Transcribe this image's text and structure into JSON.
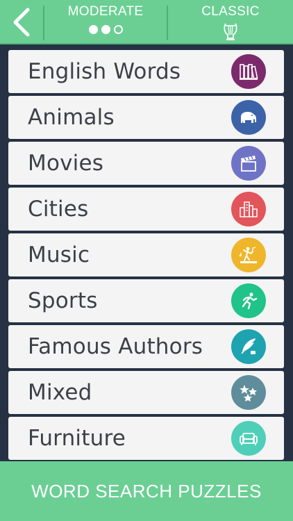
{
  "header": {
    "difficulty_label": "MODERATE",
    "mode_label": "CLASSIC",
    "difficulty_level": 2,
    "difficulty_max": 3,
    "back_icon": "chevron-left-icon",
    "mode_icon": "lyre-icon"
  },
  "categories": [
    {
      "label": "English Words",
      "icon": "books-icon",
      "color": "#7b2a6b"
    },
    {
      "label": "Animals",
      "icon": "elephant-icon",
      "color": "#3c63a8"
    },
    {
      "label": "Movies",
      "icon": "clapperboard-icon",
      "color": "#6f73c6"
    },
    {
      "label": "Cities",
      "icon": "buildings-icon",
      "color": "#e2555a"
    },
    {
      "label": "Music",
      "icon": "dancer-icon",
      "color": "#efb62c"
    },
    {
      "label": "Sports",
      "icon": "runner-icon",
      "color": "#20c38a"
    },
    {
      "label": "Famous Authors",
      "icon": "quill-icon",
      "color": "#1ea3b0"
    },
    {
      "label": "Mixed",
      "icon": "stars-icon",
      "color": "#5f8d9c"
    },
    {
      "label": "Furniture",
      "icon": "sofa-icon",
      "color": "#4fcfb8"
    }
  ],
  "footer": {
    "label": "WORD SEARCH PUZZLES"
  },
  "colors": {
    "header_bg": "#6bcf94",
    "page_bg": "#263243",
    "row_bg": "#f4f4f5",
    "text": "#3d4048"
  }
}
